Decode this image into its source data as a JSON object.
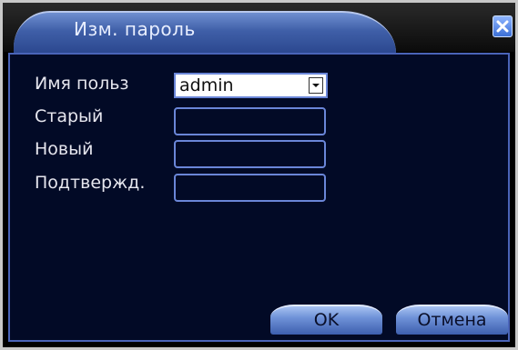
{
  "dialog": {
    "title": "Изм. пароль"
  },
  "form": {
    "user_label": "Имя польз",
    "user_value": "admin",
    "old_label": "Старый",
    "old_value": "",
    "new_label": "Новый",
    "new_value": "",
    "confirm_label": "Подтвержд.",
    "confirm_value": ""
  },
  "buttons": {
    "ok_label": "OK",
    "cancel_label": "Отмена"
  },
  "icons": {
    "close": "close-icon",
    "dropdown": "chevron-down-icon"
  },
  "colors": {
    "panel_background": "#020a26",
    "accent_blue": "#4a64b8",
    "title_blue": "#3f5fa8"
  }
}
